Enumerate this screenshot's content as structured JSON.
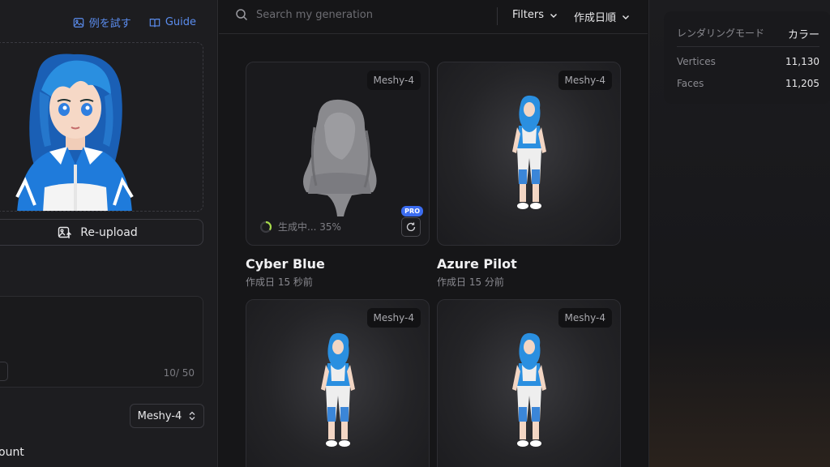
{
  "left": {
    "try_example": "例を試す",
    "guide": "Guide",
    "reupload": "Re-upload",
    "prompt_counter": "10/ 50",
    "model": "Meshy-4",
    "bottom_label": "ount"
  },
  "topbar": {
    "search_placeholder": "Search my generation",
    "filters": "Filters",
    "sort": "作成日順"
  },
  "cards": [
    {
      "badge": "Meshy-4",
      "title": "Cyber Blue",
      "date": "作成日 15 秒前",
      "progress_text": "生成中... 35%",
      "progress": 0.35,
      "pro": "PRO"
    },
    {
      "badge": "Meshy-4",
      "title": "Azure Pilot",
      "date": "作成日 15 分前"
    },
    {
      "badge": "Meshy-4"
    },
    {
      "badge": "Meshy-4"
    }
  ],
  "stats": {
    "render_mode_label": "レンダリングモード",
    "render_mode_value": "カラー",
    "vertices_label": "Vertices",
    "vertices_value": "11,130",
    "faces_label": "Faces",
    "faces_value": "11,205"
  },
  "colors": {
    "accent": "#5b8def",
    "pro": "#3b6cf0",
    "character_blue": "#2a8fe0"
  }
}
